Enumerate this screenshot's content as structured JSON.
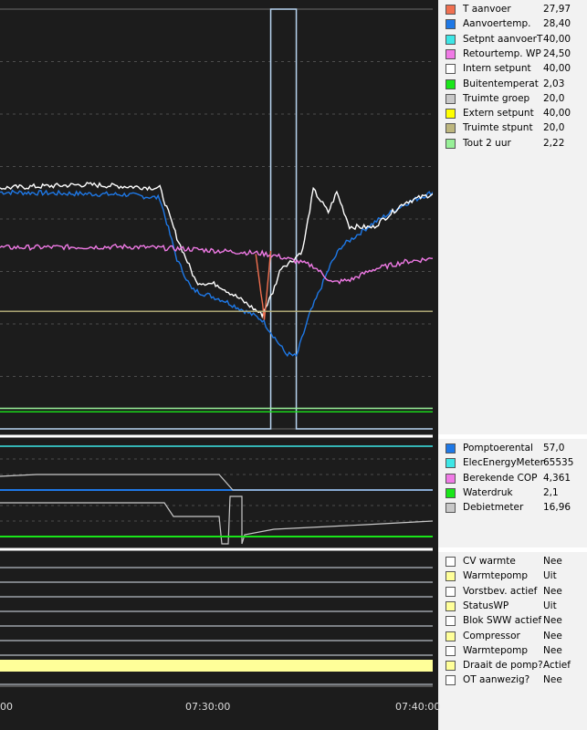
{
  "panels": [
    {
      "legend": [
        {
          "label": "T aanvoer",
          "value": "27,97",
          "color": "#f06f4f"
        },
        {
          "label": "Aanvoertemp.",
          "value": "28,40",
          "color": "#1e78e6"
        },
        {
          "label": "Setpnt aanvoerT",
          "value": "40,00",
          "color": "#3de6e6"
        },
        {
          "label": "Retourtemp. WP",
          "value": "24,50",
          "color": "#f07ae6"
        },
        {
          "label": "Intern setpunt",
          "value": "40,00",
          "color": "#ffffff"
        },
        {
          "label": "Buitentemperat",
          "value": "2,03",
          "color": "#19e619"
        },
        {
          "label": "Truimte groep",
          "value": "20,0",
          "color": "#c8c8c8"
        },
        {
          "label": "Extern setpunt",
          "value": "40,00",
          "color": "#ffff00"
        },
        {
          "label": "Truimte stpunt",
          "value": "20,0",
          "color": "#bdb67e"
        },
        {
          "label": "Tout 2 uur",
          "value": "2,22",
          "color": "#98f098"
        }
      ]
    },
    {
      "legend": [
        {
          "label": "Pomptoerental",
          "value": "57,0",
          "color": "#1e78e6"
        },
        {
          "label": "ElecEnergyMeter",
          "value": "65535",
          "color": "#3de6e6"
        },
        {
          "label": "Berekende COP",
          "value": "4,361",
          "color": "#f07ae6"
        },
        {
          "label": "Waterdruk",
          "value": "2,1",
          "color": "#19e619"
        },
        {
          "label": "Debietmeter",
          "value": "16,96",
          "color": "#c8c8c8"
        }
      ]
    },
    {
      "legend": [
        {
          "label": "CV warmte",
          "value": "Nee",
          "color": "#ffffff"
        },
        {
          "label": "Warmtepomp",
          "value": "Uit",
          "color": "#ffff99"
        },
        {
          "label": "Vorstbev. actief",
          "value": "Nee",
          "color": "#ffffff"
        },
        {
          "label": "StatusWP",
          "value": "Uit",
          "color": "#ffff99"
        },
        {
          "label": "Blok SWW actief",
          "value": "Nee",
          "color": "#ffffff"
        },
        {
          "label": "Compressor",
          "value": "Nee",
          "color": "#ffff99"
        },
        {
          "label": "Warmtepomp",
          "value": "Nee",
          "color": "#ffffff"
        },
        {
          "label": "Draait de pomp?",
          "value": "Actief",
          "color": "#ffff99"
        },
        {
          "label": "OT aanwezig?",
          "value": "Nee",
          "color": "#ffffff"
        }
      ]
    }
  ],
  "chart_data": {
    "type": "line",
    "x_ticks": [
      "00",
      "07:30:00",
      "07:40:00"
    ],
    "x_minutes": {
      "start": 7.0,
      "end": 27.3
    },
    "series": [
      {
        "name": "Aanvoertemp.",
        "color": "#1e78e6",
        "points": [
          [
            7.0,
            28.2
          ],
          [
            13.0,
            27.9
          ],
          [
            14.5,
            27.5
          ],
          [
            15.3,
            20.2
          ],
          [
            16.0,
            16.6
          ],
          [
            17.5,
            15.3
          ],
          [
            19.3,
            13.0
          ],
          [
            20.4,
            9.0
          ],
          [
            20.9,
            8.6
          ],
          [
            21.5,
            13.5
          ],
          [
            22.5,
            19.5
          ],
          [
            23.0,
            21.7
          ],
          [
            24.5,
            24.5
          ],
          [
            26.0,
            26.8
          ],
          [
            27.3,
            28.2
          ]
        ]
      },
      {
        "name": "Intern setpunt",
        "color": "#ffffff",
        "points": [
          [
            7.0,
            28.7
          ],
          [
            11.0,
            29.1
          ],
          [
            14.5,
            28.7
          ],
          [
            15.3,
            22.8
          ],
          [
            16.2,
            17.5
          ],
          [
            17.2,
            17.2
          ],
          [
            18.3,
            15.4
          ],
          [
            19.3,
            13.6
          ],
          [
            19.8,
            16.3
          ],
          [
            20.2,
            19.3
          ],
          [
            20.7,
            20.0
          ],
          [
            21.2,
            21.3
          ],
          [
            21.7,
            28.5
          ],
          [
            22.4,
            25.8
          ],
          [
            22.8,
            28.2
          ],
          [
            23.4,
            24.1
          ],
          [
            24.5,
            24.0
          ],
          [
            26.0,
            27.0
          ],
          [
            27.3,
            28.0
          ]
        ]
      },
      {
        "name": "Retourtemp. WP",
        "color": "#f07ae6",
        "points": [
          [
            7.0,
            21.6
          ],
          [
            13.0,
            21.7
          ],
          [
            16.0,
            21.4
          ],
          [
            19.3,
            20.9
          ],
          [
            20.0,
            20.6
          ],
          [
            21.7,
            19.4
          ],
          [
            22.6,
            17.4
          ],
          [
            23.5,
            17.8
          ],
          [
            24.5,
            19.0
          ],
          [
            26.0,
            19.9
          ],
          [
            27.3,
            20.3
          ]
        ]
      },
      {
        "name": "T aanvoer",
        "color": "#f06f4f",
        "points": [
          [
            19.0,
            21.0
          ],
          [
            19.4,
            13.2
          ],
          [
            19.7,
            21.2
          ]
        ]
      },
      {
        "name": "Truimte stpunt",
        "color": "#bdb67e",
        "points": [
          [
            7.0,
            14.0
          ],
          [
            27.3,
            14.0
          ]
        ]
      },
      {
        "name": "Buitentemperat",
        "color": "#19e619",
        "points": [
          [
            7.0,
            2.03
          ],
          [
            27.3,
            2.03
          ]
        ]
      },
      {
        "name": "Tout 2 uur",
        "color": "#98f098",
        "points": [
          [
            7.0,
            2.45
          ],
          [
            27.3,
            2.45
          ]
        ]
      }
    ]
  }
}
